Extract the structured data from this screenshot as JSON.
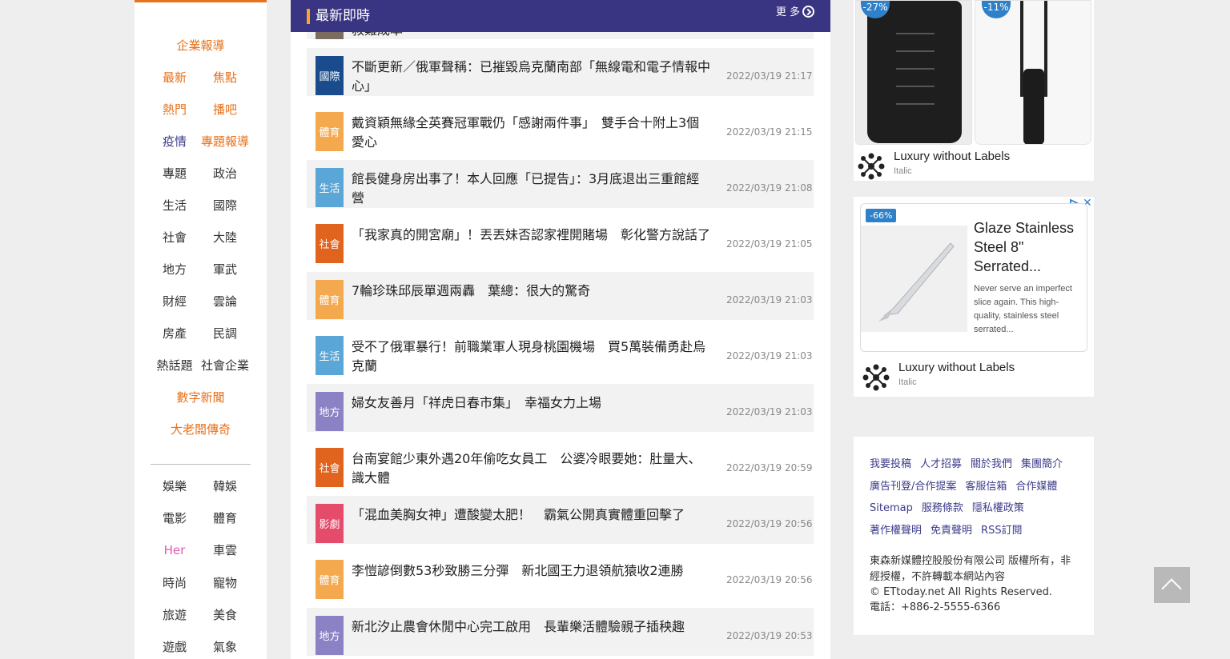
{
  "sidebar": {
    "top_items": [
      {
        "type": "single",
        "labels": [
          "企業報導"
        ],
        "colors": [
          "#e8711a"
        ]
      },
      {
        "type": "pair",
        "labels": [
          "最新",
          "焦點"
        ],
        "colors": [
          "#e8711a",
          "#e8711a"
        ]
      },
      {
        "type": "pair",
        "labels": [
          "熱門",
          "播吧"
        ],
        "colors": [
          "#e8711a",
          "#e8711a"
        ]
      },
      {
        "type": "pair",
        "labels": [
          "疫情",
          "專題報導"
        ],
        "colors": [
          "#3c3c8c",
          "#e8711a"
        ]
      },
      {
        "type": "pair",
        "labels": [
          "專題",
          "政治"
        ],
        "colors": [
          "#333333",
          "#333333"
        ]
      },
      {
        "type": "pair",
        "labels": [
          "生活",
          "國際"
        ],
        "colors": [
          "#333333",
          "#333333"
        ]
      },
      {
        "type": "pair",
        "labels": [
          "社會",
          "大陸"
        ],
        "colors": [
          "#333333",
          "#333333"
        ]
      },
      {
        "type": "pair",
        "labels": [
          "地方",
          "軍武"
        ],
        "colors": [
          "#333333",
          "#333333"
        ]
      },
      {
        "type": "pair",
        "labels": [
          "財經",
          "雲論"
        ],
        "colors": [
          "#333333",
          "#333333"
        ]
      },
      {
        "type": "pair",
        "labels": [
          "房產",
          "民調"
        ],
        "colors": [
          "#333333",
          "#333333"
        ]
      },
      {
        "type": "pair",
        "labels": [
          "熱話題",
          "社會企業"
        ],
        "colors": [
          "#333333",
          "#333333"
        ]
      },
      {
        "type": "single",
        "labels": [
          "數字新聞"
        ],
        "colors": [
          "#e8711a"
        ]
      },
      {
        "type": "single",
        "labels": [
          "大老闆傳奇"
        ],
        "colors": [
          "#e8711a"
        ]
      }
    ],
    "bottom_items": [
      {
        "type": "pair",
        "labels": [
          "娛樂",
          "韓娛"
        ],
        "colors": [
          "#333333",
          "#333333"
        ]
      },
      {
        "type": "pair",
        "labels": [
          "電影",
          "體育"
        ],
        "colors": [
          "#333333",
          "#333333"
        ]
      },
      {
        "type": "pair",
        "labels": [
          "Her",
          "車雲"
        ],
        "colors": [
          "#e05ab6",
          "#333333"
        ]
      },
      {
        "type": "pair",
        "labels": [
          "時尚",
          "寵物"
        ],
        "colors": [
          "#333333",
          "#333333"
        ]
      },
      {
        "type": "pair",
        "labels": [
          "旅遊",
          "美食"
        ],
        "colors": [
          "#333333",
          "#333333"
        ]
      },
      {
        "type": "pair",
        "labels": [
          "遊戲",
          "氣象"
        ],
        "colors": [
          "#333333",
          "#333333"
        ]
      }
    ]
  },
  "main": {
    "header_title": "最新即時",
    "more_label": "更 多",
    "peek_text": "救難成本",
    "news": [
      {
        "category": "國際",
        "category_class": "t-intl",
        "headline": "不斷更新／俄軍聲稱：已摧毀烏克蘭南部「無線電和電子情報中心」",
        "time": "2022/03/19 21:17"
      },
      {
        "category": "體育",
        "category_class": "t-sport",
        "headline": "戴資穎無緣全英賽冠軍戰仍「感謝兩件事」　雙手合十附上3個愛心",
        "time": "2022/03/19 21:15"
      },
      {
        "category": "生活",
        "category_class": "t-life",
        "headline": "館長健身房出事了！本人回應「已提告」：3月底退出三重館經營",
        "time": "2022/03/19 21:08"
      },
      {
        "category": "社會",
        "category_class": "t-social",
        "headline": "「我家真的開宮廟」！丟丟妹否認家裡開賭場　彰化警方說話了",
        "time": "2022/03/19 21:05"
      },
      {
        "category": "體育",
        "category_class": "t-sport",
        "headline": "7輪珍珠邱辰單週兩轟　葉總：很大的驚奇",
        "time": "2022/03/19 21:03"
      },
      {
        "category": "生活",
        "category_class": "t-life",
        "headline": "受不了俄軍暴行！前職業軍人現身桃園機場　買5萬裝備勇赴烏克蘭",
        "time": "2022/03/19 21:03"
      },
      {
        "category": "地方",
        "category_class": "t-local",
        "headline": "婦女友善月「祥虎日春市集」　幸福女力上場",
        "time": "2022/03/19 21:03"
      },
      {
        "category": "社會",
        "category_class": "t-social",
        "headline": "台南宴館少東外遇20年偷吃女員工　公婆冷眼要她：肚量大、識大體",
        "time": "2022/03/19 20:59"
      },
      {
        "category": "影劇",
        "category_class": "t-movie",
        "headline": "「混血美胸女神」遭酸變太肥！　霸氣公開真實體重回擊了",
        "time": "2022/03/19 20:56"
      },
      {
        "category": "體育",
        "category_class": "t-sport",
        "headline": "李愷諺倒數53秒致勝三分彈　新北國王力退領航猿收2連勝",
        "time": "2022/03/19 20:56"
      },
      {
        "category": "地方",
        "category_class": "t-local",
        "headline": "新北汐止農會休閒中心完工啟用　長輩樂活體驗親子插秧趣",
        "time": "2022/03/19 20:53"
      }
    ]
  },
  "ad1": {
    "discount_a": "-27%",
    "discount_b": "-11%",
    "brand": "Luxury without Labels",
    "brand_sub": "Italic"
  },
  "ad2": {
    "discount": "-66%",
    "product_title": "Glaze Stainless Steel 8\" Serrated...",
    "product_desc": "Never serve an imperfect slice again. This high-quality, stainless steel serrated...",
    "close_label": "✕",
    "brand": "Luxury without Labels",
    "brand_sub": "Italic"
  },
  "footer": {
    "link_rows": [
      [
        "我要投稿",
        "人才招募",
        "關於我們",
        "集團簡介"
      ],
      [
        "廣告刊登/合作提案",
        "客服信箱",
        "合作媒體"
      ],
      [
        "Sitemap",
        "服務條款",
        "隱私權政策"
      ],
      [
        "著作權聲明",
        "免責聲明",
        "RSS訂閱"
      ]
    ],
    "copyright_lines": [
      "東森新媒體控股股份有限公司 版權所有，非經授權，不許轉載本網站內容",
      "© ETtoday.net All Rights Reserved.",
      "電話：+886-2-5555-6366"
    ]
  },
  "icons": {
    "more": "arrow-circle-right-icon",
    "back_to_top": "chevron-up-icon",
    "ad_choices": "ad-choices-icon",
    "brand_logo": "brand-logo-icon"
  }
}
